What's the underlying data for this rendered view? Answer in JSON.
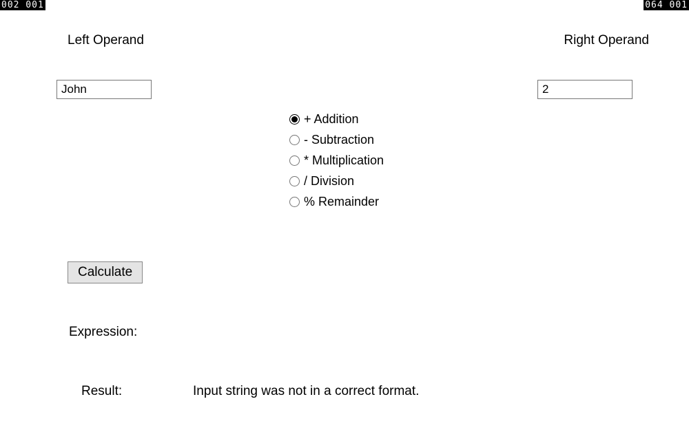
{
  "corners": {
    "top_left": "002  001",
    "top_right": "064  001"
  },
  "labels": {
    "left_operand": "Left Operand",
    "right_operand": "Right Operand",
    "expression": "Expression:",
    "result": "Result:"
  },
  "inputs": {
    "left_value": "John",
    "right_value": "2"
  },
  "operations": [
    {
      "label": "+ Addition",
      "selected": true
    },
    {
      "label": "- Subtraction",
      "selected": false
    },
    {
      "label": "* Multiplication",
      "selected": false
    },
    {
      "label": "/ Division",
      "selected": false
    },
    {
      "label": "% Remainder",
      "selected": false
    }
  ],
  "buttons": {
    "calculate": "Calculate"
  },
  "output": {
    "expression_value": "",
    "result_value": "Input string was not in a correct format."
  }
}
